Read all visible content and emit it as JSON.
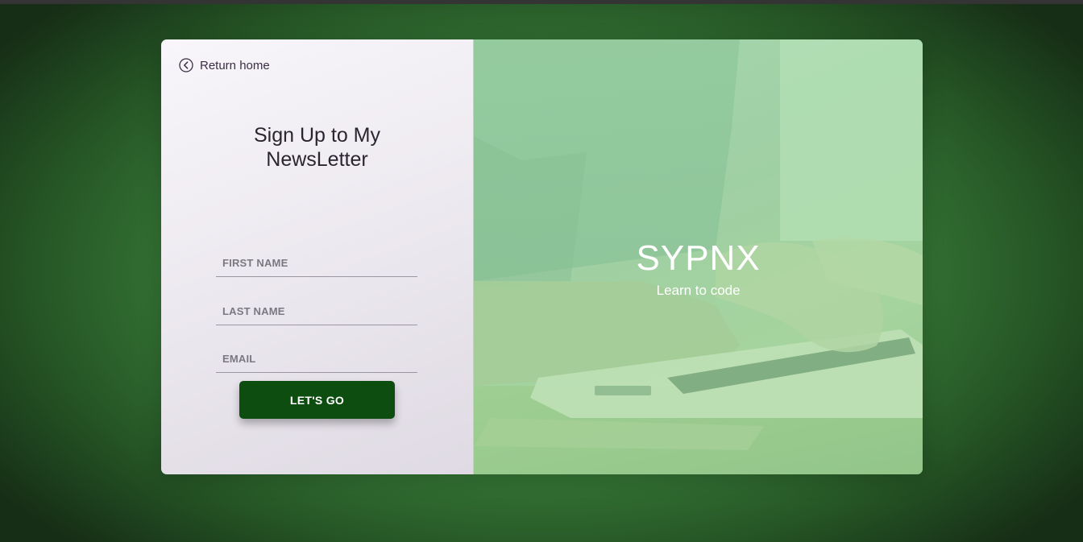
{
  "nav": {
    "return_label": "Return home",
    "return_icon": "chevron-left-circle-icon"
  },
  "form": {
    "title_line1": "Sign Up to My",
    "title_line2": "NewsLetter",
    "first_name_placeholder": "FIRST NAME",
    "first_name_value": "",
    "last_name_placeholder": "LAST NAME",
    "last_name_value": "",
    "email_placeholder": "EMAIL",
    "email_value": "",
    "submit_label": "LET'S GO"
  },
  "hero": {
    "brand_name": "SYPNX",
    "tagline": "Learn to code"
  },
  "colors": {
    "accent": "#0d4d10",
    "background": "#3a7f3a",
    "hero_overlay": "#9fd0a4",
    "text_dark": "#2b2530"
  }
}
